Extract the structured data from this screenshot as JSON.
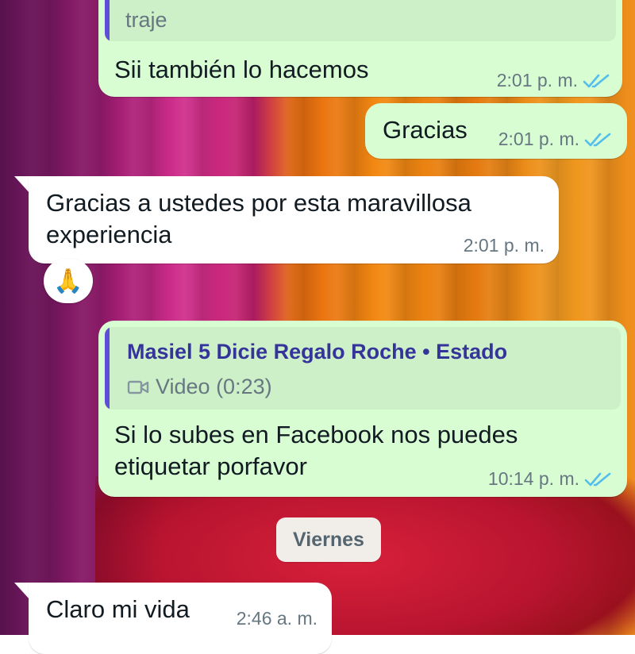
{
  "messages": [
    {
      "direction": "outgoing",
      "quote_text": "traje",
      "text": "Sii también lo hacemos",
      "time": "2:01 p. m.",
      "status_icon": "double-check-read-icon"
    },
    {
      "direction": "outgoing",
      "text": "Gracias",
      "time": "2:01 p. m.",
      "status_icon": "double-check-read-icon"
    },
    {
      "direction": "incoming",
      "text_line1": "Gracias a ustedes por esta maravillosa",
      "text_line2": "experiencia",
      "time": "2:01 p. m.",
      "reaction": "🙏"
    },
    {
      "direction": "outgoing",
      "quote_sender": "Masiel 5 Dicie Regalo Roche • Estado",
      "quote_media_icon": "video-camera-icon",
      "quote_media_label": "Video (0:23)",
      "text_line1": "Si lo subes en Facebook nos puedes",
      "text_line2": "etiquetar porfavor",
      "time": "10:14 p. m.",
      "status_icon": "double-check-read-icon"
    },
    {
      "direction": "incoming",
      "text": "Claro mi vida",
      "time": "2:46 a. m."
    }
  ],
  "date_separator": "Viernes",
  "colors": {
    "outgoing_bubble": "#d9fdd3",
    "incoming_bubble": "#ffffff",
    "read_ticks": "#53bdeb",
    "quote_accent": "#5e4fd6"
  }
}
